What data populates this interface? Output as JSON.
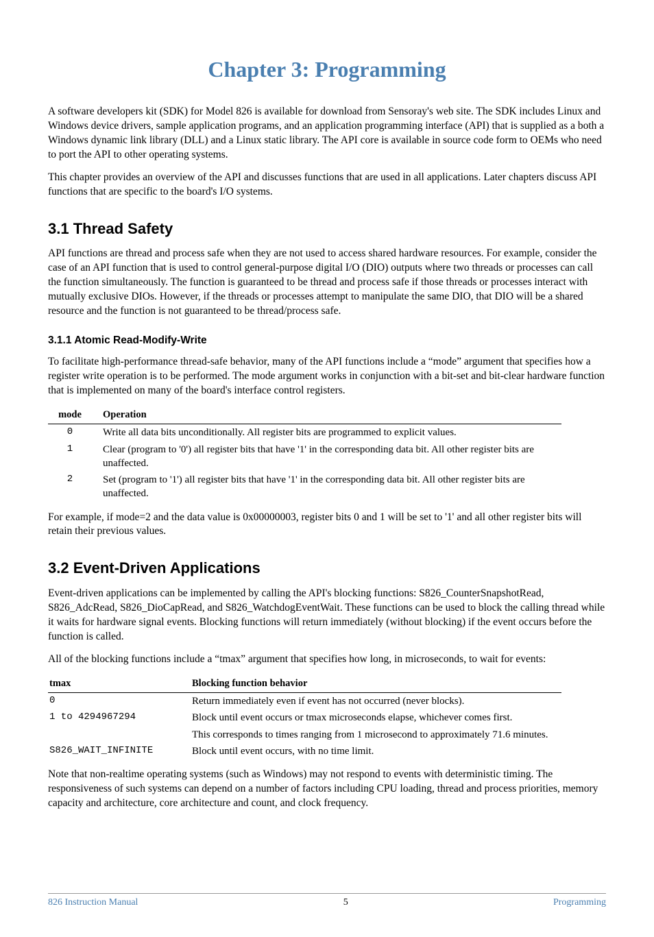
{
  "chapter_title": "Chapter 3: Programming",
  "intro_p1": "A software developers kit (SDK) for Model 826 is available for download from Sensoray's web site. The SDK includes Linux and Windows device drivers, sample application programs, and an application programming interface (API) that is supplied as a both a Windows dynamic link library (DLL) and a Linux static library. The API core is available in source code form to OEMs who need to port the API to other operating systems.",
  "intro_p2": "This chapter provides an overview of the API and discusses functions that are used in all applications. Later chapters discuss API functions that are specific to the board's I/O systems.",
  "section_3_1": {
    "heading": "3.1  Thread Safety",
    "p1": "API functions are thread and process safe when they are not used to access shared hardware resources. For example, consider the case of an API function that is used to control general-purpose digital I/O (DIO) outputs where two threads or processes can call the function simultaneously. The function is guaranteed to be thread and process safe if those threads or processes interact with mutually exclusive DIOs. However, if the threads or processes attempt to manipulate the same DIO, that DIO will be a shared resource and the function is not guaranteed to be thread/process safe.",
    "sub_3_1_1": {
      "heading": "3.1.1   Atomic Read-Modify-Write",
      "p1": "To facilitate high-performance thread-safe behavior, many of the API functions include a “mode” argument that specifies how a register write operation is to be performed. The mode argument works in conjunction with a bit-set and bit-clear hardware function that is implemented on many of the board's interface control registers.",
      "table": {
        "headers": {
          "mode": "mode",
          "operation": "Operation"
        },
        "rows": [
          {
            "mode": "0",
            "operation": "Write all data bits unconditionally. All register bits are programmed to explicit values."
          },
          {
            "mode": "1",
            "operation": "Clear (program to '0') all register bits that have '1' in the corresponding data bit. All other register bits are unaffected."
          },
          {
            "mode": "2",
            "operation": "Set (program to '1') all register bits that have '1' in the corresponding data bit. All other register bits are unaffected."
          }
        ]
      },
      "p2": "For example, if mode=2 and the data value is 0x00000003, register bits 0 and 1 will be set to '1' and all other register bits will retain their previous values."
    }
  },
  "section_3_2": {
    "heading": "3.2  Event-Driven Applications",
    "p1": "Event-driven applications can be implemented by calling the API's blocking functions: S826_CounterSnapshotRead, S826_AdcRead, S826_DioCapRead, and S826_WatchdogEventWait. These functions can be used to block the calling thread while it waits for hardware signal events. Blocking functions will return immediately (without blocking) if the event occurs before the function is called.",
    "p2": "All of the blocking functions include a “tmax” argument that specifies how long, in microseconds, to wait for events:",
    "table": {
      "headers": {
        "tmax": "tmax",
        "behavior": "Blocking function behavior"
      },
      "rows": [
        {
          "tmax": "0",
          "behavior": "Return immediately even if event has not occurred (never blocks)."
        },
        {
          "tmax": "1 to 4294967294",
          "behavior": "Block until event occurs or tmax microseconds elapse, whichever comes first."
        },
        {
          "tmax": "",
          "behavior": "This corresponds to times ranging from 1 microsecond to approximately 71.6 minutes."
        },
        {
          "tmax": "S826_WAIT_INFINITE",
          "behavior": "Block until event occurs, with no time limit."
        }
      ]
    },
    "p3": "Note that non-realtime operating systems (such as Windows) may not respond to events with deterministic timing. The responsiveness of such systems can depend on a number of factors including CPU loading, thread and process priorities, memory capacity and architecture, core architecture and count, and clock frequency."
  },
  "footer": {
    "left": "826 Instruction Manual",
    "center": "5",
    "right": "Programming"
  }
}
